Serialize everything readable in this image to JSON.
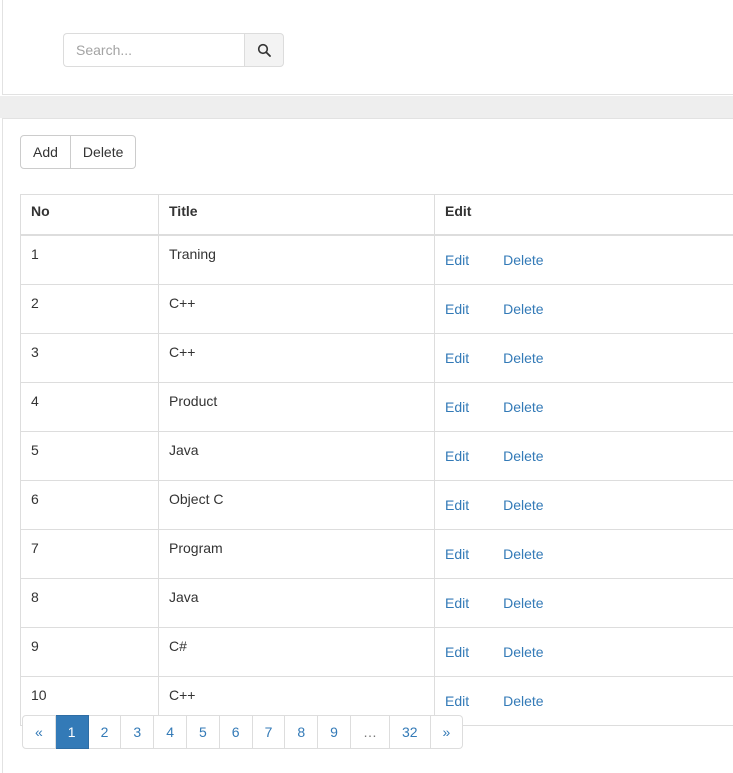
{
  "search": {
    "placeholder": "Search...",
    "value": "",
    "button_icon": "search-icon"
  },
  "toolbar": {
    "add_label": "Add",
    "delete_label": "Delete"
  },
  "table": {
    "columns": [
      "No",
      "Title",
      "Edit"
    ],
    "rows": [
      {
        "no": "1",
        "title": "Traning",
        "edit": "Edit",
        "delete": "Delete"
      },
      {
        "no": "2",
        "title": "C++",
        "edit": "Edit",
        "delete": "Delete"
      },
      {
        "no": "3",
        "title": "C++",
        "edit": "Edit",
        "delete": "Delete"
      },
      {
        "no": "4",
        "title": "Product",
        "edit": "Edit",
        "delete": "Delete"
      },
      {
        "no": "5",
        "title": "Java",
        "edit": "Edit",
        "delete": "Delete"
      },
      {
        "no": "6",
        "title": "Object C",
        "edit": "Edit",
        "delete": "Delete"
      },
      {
        "no": "7",
        "title": "Program",
        "edit": "Edit",
        "delete": "Delete"
      },
      {
        "no": "8",
        "title": "Java",
        "edit": "Edit",
        "delete": "Delete"
      },
      {
        "no": "9",
        "title": "C#",
        "edit": "Edit",
        "delete": "Delete"
      },
      {
        "no": "10",
        "title": "C++",
        "edit": "Edit",
        "delete": "Delete"
      }
    ]
  },
  "pagination": {
    "items": [
      {
        "label": "«",
        "name": "page-prev",
        "active": false,
        "ellipsis": false
      },
      {
        "label": "1",
        "name": "page-1",
        "active": true,
        "ellipsis": false
      },
      {
        "label": "2",
        "name": "page-2",
        "active": false,
        "ellipsis": false
      },
      {
        "label": "3",
        "name": "page-3",
        "active": false,
        "ellipsis": false
      },
      {
        "label": "4",
        "name": "page-4",
        "active": false,
        "ellipsis": false
      },
      {
        "label": "5",
        "name": "page-5",
        "active": false,
        "ellipsis": false
      },
      {
        "label": "6",
        "name": "page-6",
        "active": false,
        "ellipsis": false
      },
      {
        "label": "7",
        "name": "page-7",
        "active": false,
        "ellipsis": false
      },
      {
        "label": "8",
        "name": "page-8",
        "active": false,
        "ellipsis": false
      },
      {
        "label": "9",
        "name": "page-9",
        "active": false,
        "ellipsis": false
      },
      {
        "label": "…",
        "name": "page-ellipsis",
        "active": false,
        "ellipsis": true
      },
      {
        "label": "32",
        "name": "page-32",
        "active": false,
        "ellipsis": false
      },
      {
        "label": "»",
        "name": "page-next",
        "active": false,
        "ellipsis": false
      }
    ]
  },
  "colors": {
    "primary": "#337ab7",
    "primary_border": "#2e6da4",
    "link": "#337ab7",
    "band": "#eeeeee",
    "border": "#dddddd",
    "text": "#333333"
  }
}
